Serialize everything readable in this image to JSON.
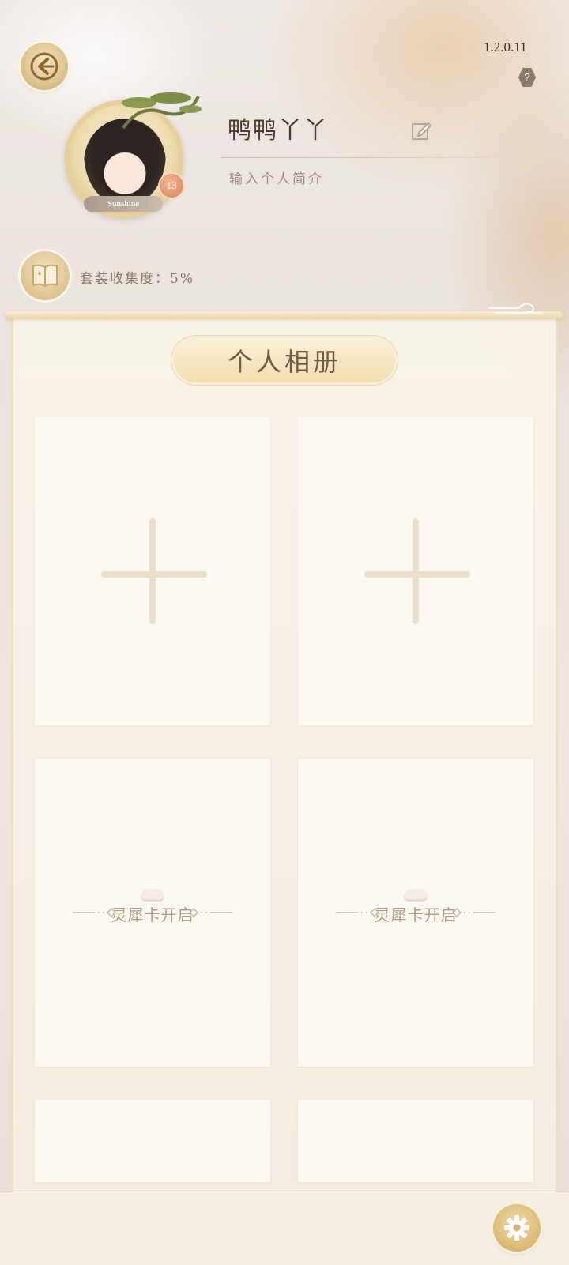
{
  "header": {
    "version": "1.2.0.11",
    "help_label": "?"
  },
  "profile": {
    "username": "鸭鸭丫丫",
    "avatar_nameplate": "Sunshine",
    "level": "13",
    "bio_placeholder": "输入个人简介"
  },
  "collection": {
    "text": "套装收集度：5%"
  },
  "album": {
    "title": "个人相册",
    "locked_label": "灵犀卡开启"
  },
  "colors": {
    "accent_gold": "#d8b56e",
    "text_brown": "#4c3b2e",
    "panel_bg": "#fdf8f2"
  },
  "icons": {
    "back": "back-arrow-icon",
    "edit": "edit-icon",
    "collection": "book-icon",
    "settings": "gear-icon",
    "add": "plus-icon"
  }
}
